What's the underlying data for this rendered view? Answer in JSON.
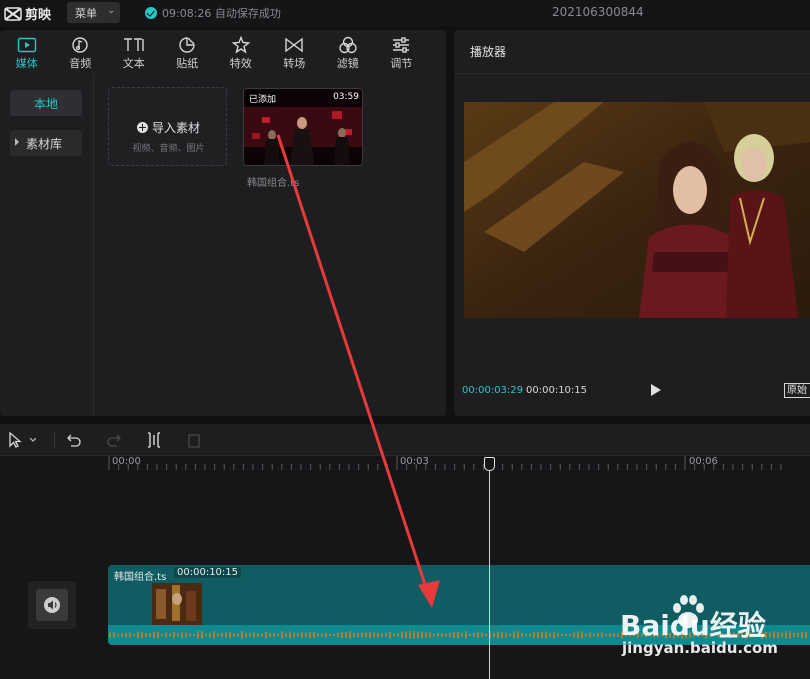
{
  "app": {
    "name": "剪映",
    "menu_label": "菜单",
    "save_status": "09:08:26 自动保存成功",
    "project_name": "202106300844"
  },
  "media_panel": {
    "tabs": [
      {
        "label": "媒体",
        "icon": "media-icon",
        "active": true
      },
      {
        "label": "音频",
        "icon": "audio-icon",
        "active": false
      },
      {
        "label": "文本",
        "icon": "text-icon",
        "active": false
      },
      {
        "label": "贴纸",
        "icon": "sticker-icon",
        "active": false
      },
      {
        "label": "特效",
        "icon": "effects-icon",
        "active": false
      },
      {
        "label": "转场",
        "icon": "transition-icon",
        "active": false
      },
      {
        "label": "滤镜",
        "icon": "filter-icon",
        "active": false
      },
      {
        "label": "调节",
        "icon": "adjust-icon",
        "active": false
      }
    ],
    "sidebar": {
      "local": "本地",
      "library": "素材库"
    },
    "import": {
      "title": "导入素材",
      "subtitle": "视频、音频、图片"
    },
    "clip": {
      "badge": "已添加",
      "duration": "03:59",
      "name": "韩国组合.ts"
    }
  },
  "player": {
    "title": "播放器",
    "current_time": "00:00:03:29",
    "total_time": "00:00:10:15",
    "ratio_label": "原始"
  },
  "timeline": {
    "ruler": [
      "00:00",
      "00:03",
      "00:06"
    ],
    "clip_name": "韩国组合.ts",
    "clip_duration": "00:00:10:15"
  },
  "watermark": {
    "brand": "Baidu经验",
    "url": "jingyan.baidu.com"
  },
  "colors": {
    "accent": "#29c6c6",
    "panel": "#1e1e20",
    "track": "#0f5d62",
    "annotation_arrow": "#e83a3a"
  }
}
